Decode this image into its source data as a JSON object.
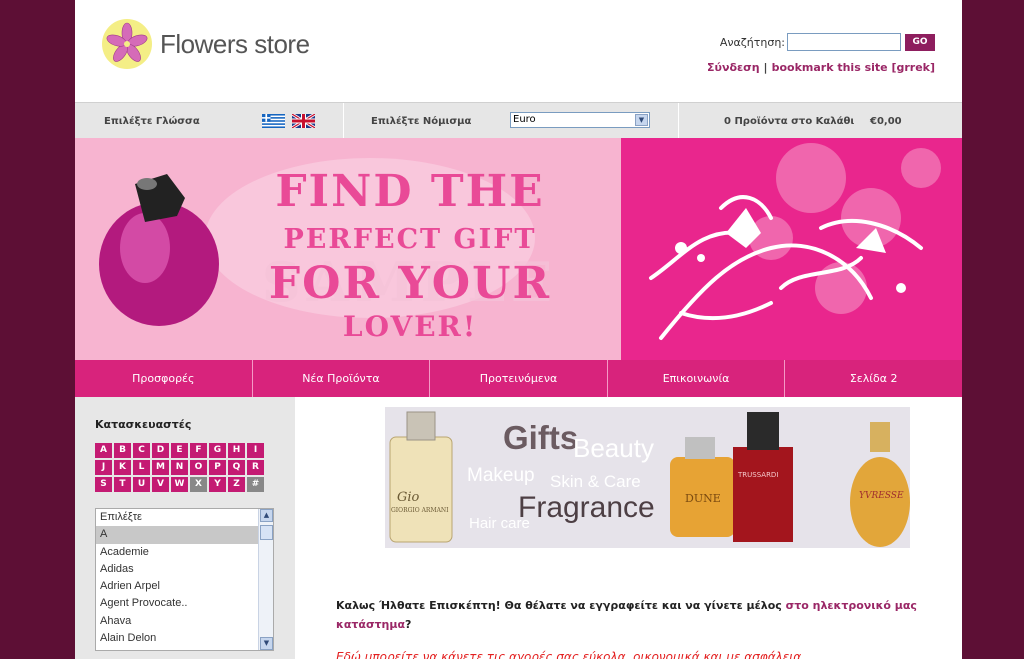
{
  "header": {
    "logo_text": "Flowers store",
    "search_label": "Αναζήτηση:",
    "search_value": "",
    "go_label": "GO",
    "login_link": "Σύνδεση",
    "separator": "|",
    "bookmark_link": "bookmark this site [grrek]"
  },
  "selector_bar": {
    "language_label": "Επιλέξτε Γλώσσα",
    "currency_label": "Επιλέξτε Νόμισμα",
    "currency_value": "Euro",
    "cart_label": "0 Προϊόντα στο Καλάθι",
    "cart_total": "€0,00"
  },
  "banner": {
    "line1": "FIND THE",
    "line2": "PERFECT GIFT",
    "line3": "FOR YOUR",
    "line4": "LOVER!",
    "watermark": "SAMPLE"
  },
  "nav": [
    "Προσφορές",
    "Νέα Προϊόντα",
    "Προτεινόμενα",
    "Επικοινωνία",
    "Σελίδα 2"
  ],
  "sidebar": {
    "title": "Κατασκευαστές",
    "letters": [
      "A",
      "B",
      "C",
      "D",
      "E",
      "F",
      "G",
      "H",
      "I",
      "J",
      "K",
      "L",
      "M",
      "N",
      "O",
      "P",
      "Q",
      "R",
      "S",
      "T",
      "U",
      "V",
      "W",
      "X",
      "Y",
      "Z",
      "#"
    ],
    "disabled_letters": [
      "X",
      "#"
    ],
    "manufacturers": [
      "Επιλέξτε",
      "A",
      "Academie",
      "Adidas",
      "Adrien Arpel",
      "Agent Provocate..",
      "Ahava",
      "Alain Delon"
    ],
    "selected_index": 1
  },
  "product_banner": {
    "words": [
      "Gifts",
      "Beauty",
      "Makeup",
      "Skin & Care",
      "Fragrance",
      "Hair care"
    ],
    "bottle1_label": "Gio",
    "bottle1_brand": "GIORGIO ARMANI",
    "bottle2_label": "DUNE",
    "bottle3_label": "TRUSSARDI",
    "bottle4_label": "YVRESSE"
  },
  "content": {
    "welcome_text": "Καλως Ήλθατε Επισκέπτη! Θα θέλατε να εγγραφείτε και να γίνετε μέλος ",
    "welcome_link": "στο ηλεκτρονικό μας κατάστημα",
    "welcome_end": "?",
    "promo_text": "Εδώ μπορείτε να κάνετε τις αγορές σας εύκολα, οικονομικά και με ασφάλεια"
  },
  "colors": {
    "background": "#5d0f35",
    "accent": "#d8237c",
    "link": "#9a2766"
  }
}
